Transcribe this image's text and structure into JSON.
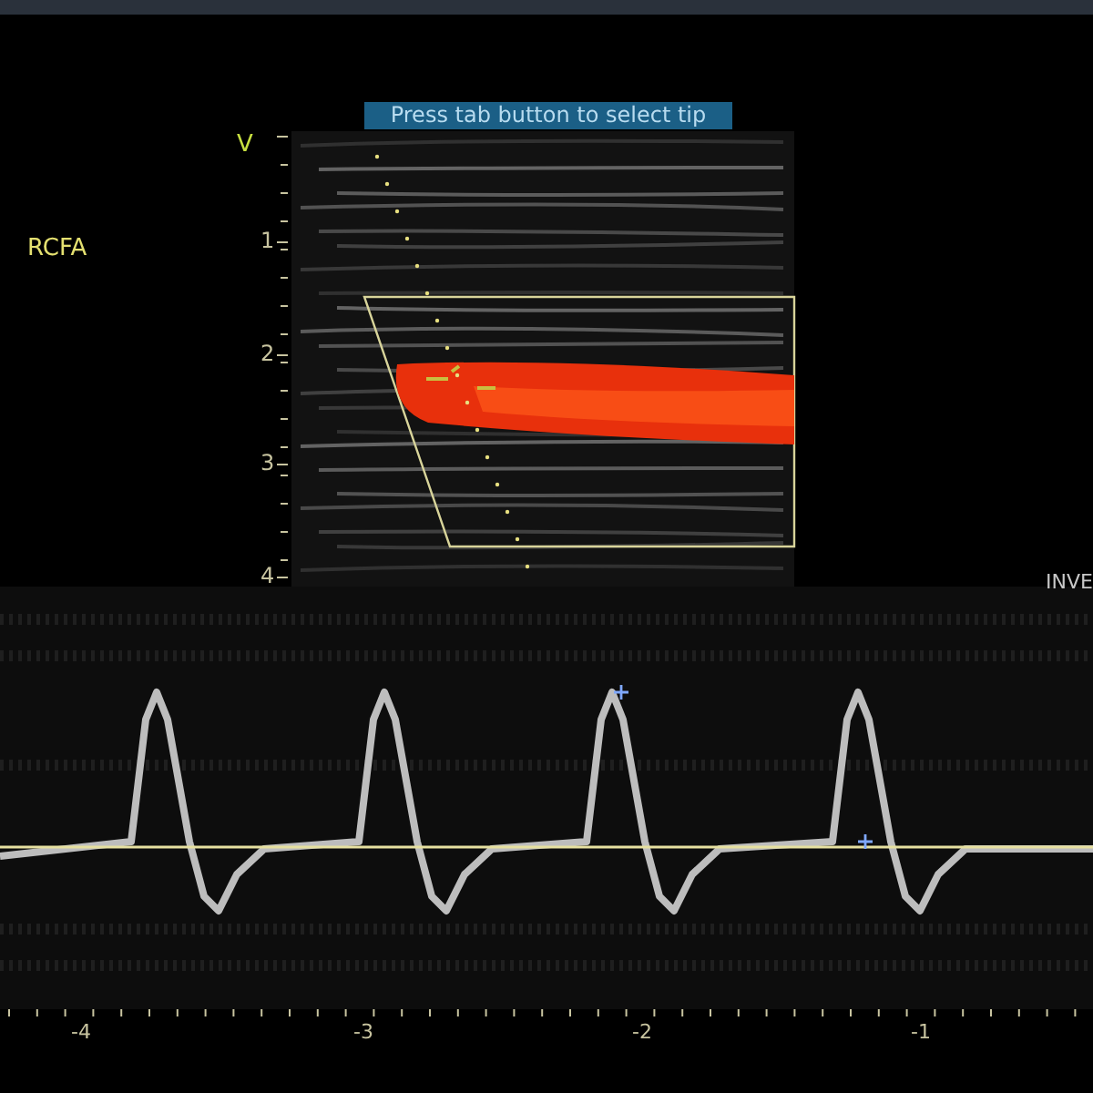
{
  "hint_banner": {
    "text": "Press tab button to select tip"
  },
  "probe_orientation": "V",
  "vessel_label": "RCFA",
  "depth_scale": [
    "1",
    "2",
    "3",
    "4"
  ],
  "doppler_label": "INVE",
  "time_axis": [
    "-4",
    "-3",
    "-2",
    "-1"
  ]
}
